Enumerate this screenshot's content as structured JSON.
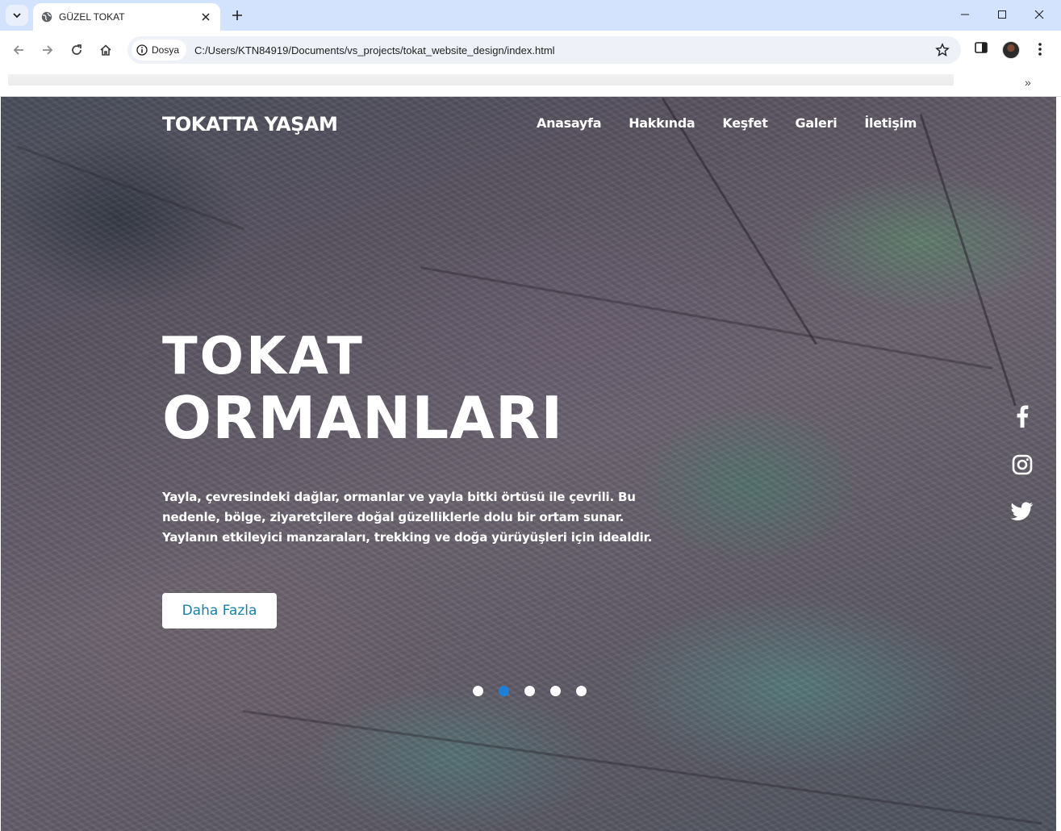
{
  "browser": {
    "tab_title": "GÜZEL TOKAT",
    "site_info_label": "Dosya",
    "url": "C:/Users/KTN84919/Documents/vs_projects/tokat_website_design/index.html",
    "bookmarks_more": "»"
  },
  "site": {
    "brand": "TOKATTA YAŞAM",
    "nav": [
      "Anasayfa",
      "Hakkında",
      "Keşfet",
      "Galeri",
      "İletişim"
    ],
    "hero": {
      "line1": "TOKAT",
      "line2": "ORMANLARI",
      "description": "Yayla, çevresindeki dağlar, ormanlar ve yayla bitki örtüsü ile çevrili. Bu nedenle, bölge, ziyaretçilere doğal güzelliklerle dolu bir ortam sunar. Yaylanın etkileyici manzaraları, trekking ve doğa yürüyüşleri için idealdir.",
      "button": "Daha Fazla"
    },
    "slider": {
      "count": 5,
      "active_index": 2
    },
    "social": [
      "facebook-icon",
      "instagram-icon",
      "twitter-icon"
    ],
    "colors": {
      "cta_text": "#1a7fa8",
      "active_dot": "#1e7fd6"
    }
  }
}
